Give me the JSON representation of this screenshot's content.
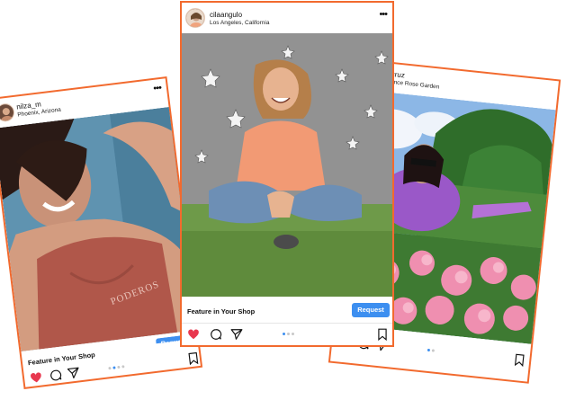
{
  "posts": [
    {
      "username": "nilza_m",
      "location": "Phoenix, Arizona",
      "feature_label": "Feature in Your Shop",
      "request_label": "Request",
      "menu_icon": "more-horizontal-icon",
      "liked": true,
      "pagination_total": 4,
      "pagination_active": 1,
      "photo_caption": "PODEROS"
    },
    {
      "username": "cilaangulo",
      "location": "Los Angeles, California",
      "feature_label": "Feature in Your Shop",
      "request_label": "Request",
      "menu_icon": "more-horizontal-icon",
      "liked": true,
      "pagination_total": 3,
      "pagination_active": 0
    },
    {
      "username": "maritzalcruz",
      "location": "Point Defiance Rose Garden",
      "menu_icon": "more-horizontal-icon",
      "liked": false,
      "pagination_total": 2,
      "pagination_active": 0
    }
  ],
  "colors": {
    "frame": "#f26a2e",
    "accent_blue": "#3d8ff0",
    "heart_red": "#e8384f"
  }
}
